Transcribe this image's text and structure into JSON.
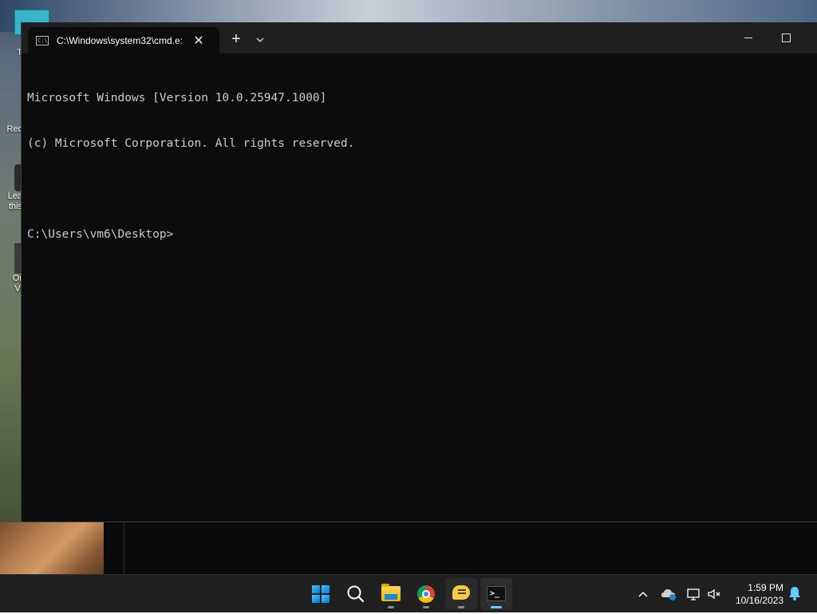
{
  "desktop": {
    "icons": [
      {
        "name": "recycle-bin",
        "label": "Rec"
      },
      {
        "name": "learn-icon",
        "label": "Lea\nthis"
      },
      {
        "name": "oracle-vm-icon",
        "label": "Or\nVi"
      }
    ]
  },
  "terminal": {
    "tab_title": "C:\\Windows\\system32\\cmd.e:",
    "new_tab_label": "+",
    "close_glyph": "✕",
    "lines": [
      "Microsoft Windows [Version 10.0.25947.1000]",
      "(c) Microsoft Corporation. All rights reserved.",
      "",
      "C:\\Users\\vm6\\Desktop>"
    ]
  },
  "taskbar": {
    "apps": [
      "start",
      "search",
      "file-explorer",
      "chrome",
      "chat-app",
      "terminal"
    ],
    "active_app": "terminal",
    "clock": {
      "time": "1:59 PM",
      "date": "10/16/2023"
    },
    "tray_chevron": "^"
  },
  "colors": {
    "accent": "#60cdff",
    "console_bg": "#0c0c0c",
    "console_fg": "#cccccc",
    "taskbar_bg": "#202020"
  }
}
